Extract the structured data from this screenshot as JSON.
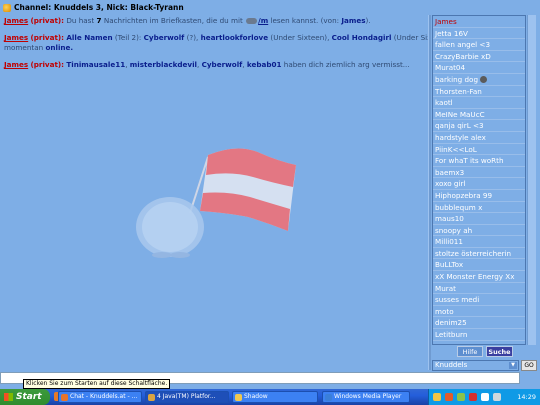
{
  "title_bar": {
    "title": "Channel: Knuddels 3,  Nick: Black-Tyrann"
  },
  "chat": {
    "messages": [
      {
        "sender": "James",
        "tag": "(privat):",
        "pre_text": " Du hast ",
        "count": "7",
        "mid_text": " Nachrichten im Briefkasten, die du mit ",
        "cmd": "/m",
        "post_text": " lesen kannst. (von: ",
        "from": "James",
        "end": ")."
      },
      {
        "sender": "James",
        "tag": "(privat):",
        "n1": "Alle Namen",
        "t1": " (Teil 2): ",
        "n2": "Cyberwolf",
        "t2": " (?), ",
        "n3": "heartlookforlove",
        "t3": " (Under Sixteen), ",
        "n4": "Cool Hondagirl",
        "t4": " (Under Sixteen)",
        "line2_pre": "momentan ",
        "line2_online": "online."
      },
      {
        "sender": "James",
        "tag": "(privat):",
        "n1": "Tinimausale11",
        "s1": ", ",
        "n2": "misterblackdevil",
        "s2": ", ",
        "n3": "Cyberwolf",
        "s3": ", ",
        "n4": "kebab01",
        "tail": " haben dich ziemlich arg vermisst..."
      }
    ]
  },
  "users": [
    {
      "name": "James",
      "color": "red"
    },
    {
      "name": "Jetta 16V"
    },
    {
      "name": "fallen angel <3"
    },
    {
      "name": "CrazyBarbie xD"
    },
    {
      "name": "Murat04"
    },
    {
      "name": "barking dog",
      "icon": "away-icon"
    },
    {
      "name": "Thorsten-Fan"
    },
    {
      "name": "kaotl"
    },
    {
      "name": "MeINe MaUcC"
    },
    {
      "name": "qanja qirL <3"
    },
    {
      "name": "hardstyle alex"
    },
    {
      "name": "PiinK<<LoL"
    },
    {
      "name": "For whaT its woRth"
    },
    {
      "name": "baemx3"
    },
    {
      "name": "xoxo girl"
    },
    {
      "name": "Hiphopzebra 99"
    },
    {
      "name": "bubblequm x"
    },
    {
      "name": "maus10"
    },
    {
      "name": "snoopy ah"
    },
    {
      "name": "Milli011"
    },
    {
      "name": "stoltze österreicherin"
    },
    {
      "name": "BuLLTox"
    },
    {
      "name": "xX Monster Energy Xx"
    },
    {
      "name": "Murat"
    },
    {
      "name": "susses medi"
    },
    {
      "name": "moto"
    },
    {
      "name": "denim25"
    },
    {
      "name": "Letitburn"
    }
  ],
  "buttons": {
    "help": "Hilfe",
    "search": "Suche",
    "go": "GO"
  },
  "channel_select": {
    "value": "Knuddels"
  },
  "input": {
    "value": ""
  },
  "tooltip": {
    "text": "Klicken Sie zum Starten auf diese Schaltfläche."
  },
  "taskbar": {
    "start": "Start",
    "tasks": [
      {
        "label": "Chat - Knuddels.at - ...",
        "icon_color": "#e8742a"
      },
      {
        "label": "4 Java(TM) Platfor...",
        "icon_color": "#d9a441",
        "active": true
      },
      {
        "label": "Shadow",
        "icon_color": "#f0c850"
      },
      {
        "label": "Windows Media Player",
        "icon_color": "#3a7fd9"
      }
    ],
    "clock": "14:29"
  }
}
